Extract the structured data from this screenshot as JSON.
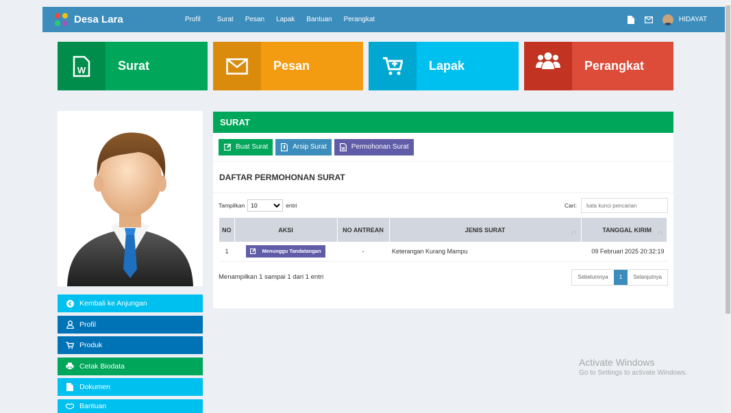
{
  "brand": "Desa Lara",
  "nav": [
    "Profil",
    "Surat",
    "Pesan",
    "Lapak",
    "Bantuan",
    "Perangkat"
  ],
  "user": "HIDAYAT",
  "tiles": [
    {
      "label": "Surat",
      "icon": "word-file-icon",
      "color": "#00a65a",
      "icon_bg": "#008d4c"
    },
    {
      "label": "Pesan",
      "icon": "envelope-icon",
      "color": "#f39c12",
      "icon_bg": "#db8b0b"
    },
    {
      "label": "Lapak",
      "icon": "cart-plus-icon",
      "color": "#00c0ef",
      "icon_bg": "#00a7d0"
    },
    {
      "label": "Perangkat",
      "icon": "users-icon",
      "color": "#dd4b39",
      "icon_bg": "#c23321"
    }
  ],
  "sidebar": [
    {
      "label": "Kembali ke Anjungan",
      "icon": "circle-arrow-left-icon",
      "color": "#00c0ef"
    },
    {
      "label": "Profil",
      "icon": "user-icon",
      "color": "#0073b7"
    },
    {
      "label": "Produk",
      "icon": "cart-icon",
      "color": "#0073b7"
    },
    {
      "label": "Cetak Biodata",
      "icon": "printer-icon",
      "color": "#00a65a"
    },
    {
      "label": "Dokumen",
      "icon": "document-icon",
      "color": "#00c0ef"
    },
    {
      "label": "Bantuan",
      "icon": "handshake-icon",
      "color": "#00c0ef"
    }
  ],
  "main": {
    "header": "SURAT",
    "buttons": [
      {
        "label": "Buat Surat",
        "icon": "edit-icon",
        "color": "#00a65a"
      },
      {
        "label": "Arsip Surat",
        "icon": "archive-file-icon",
        "color": "#3c8dbc"
      },
      {
        "label": "Permohonan Surat",
        "icon": "word-file-icon",
        "color": "#605ca8"
      }
    ],
    "subtitle": "DAFTAR PERMOHONAN SURAT",
    "show_prefix": "Tampilkan",
    "show_value": "10",
    "show_suffix": "entri",
    "search_label": "Cari:",
    "search_placeholder": "kata kunci pencarian",
    "columns": [
      "NO",
      "AKSI",
      "NO ANTREAN",
      "JENIS SURAT",
      "TANGGAL KIRIM"
    ],
    "rows": [
      {
        "no": "1",
        "aksi": "Menunggu Tandatangan",
        "antrean": "-",
        "jenis": "Keterangan Kurang Mampu",
        "tanggal": "09 Februari 2025 20:32:19"
      }
    ],
    "info": "Menampilkan 1 sampai 1 dari 1 entri",
    "pager": {
      "prev": "Sebelumnya",
      "page": "1",
      "next": "Selanjutnya"
    }
  },
  "watermark": {
    "title": "Activate Windows",
    "subtitle": "Go to Settings to activate Windows."
  }
}
